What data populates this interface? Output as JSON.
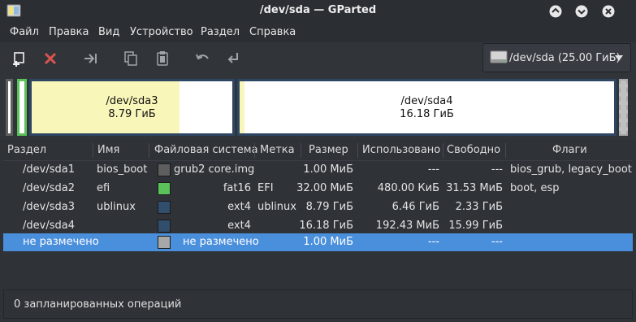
{
  "window": {
    "title": "/dev/sda — GParted",
    "colors": {
      "minimize": "#ffffff",
      "maximize": "#ffffff",
      "close": "#ffffff"
    }
  },
  "menu": {
    "items": [
      "Файл",
      "Правка",
      "Вид",
      "Устройство",
      "Раздел",
      "Справка"
    ]
  },
  "toolbar": {
    "buttons": [
      "new-partition-icon",
      "delete-icon",
      "resize-move-icon",
      "copy-icon",
      "paste-icon",
      "undo-icon",
      "apply-icon"
    ],
    "device": "/dev/sda (25.00 ГиБ)"
  },
  "disk_map": {
    "segments": [
      {
        "name": "/dev/sda3",
        "size": "8.79 ГиБ",
        "used_fraction": 0.735
      },
      {
        "name": "/dev/sda4",
        "size": "16.18 ГиБ",
        "used_fraction": 0.012
      }
    ]
  },
  "table": {
    "headers": [
      "Раздел",
      "Имя",
      "Файловая система",
      "Метка",
      "Размер",
      "Использовано",
      "Свободно",
      "Флаги"
    ],
    "rows": [
      {
        "partition": "/dev/sda1",
        "name": "bios_boot",
        "color": "#5e5e5e",
        "fs": "grub2 core.img",
        "label": "",
        "size": "1.00 МиБ",
        "used": "---",
        "free": "---",
        "flags": "bios_grub, legacy_boot"
      },
      {
        "partition": "/dev/sda2",
        "name": "efi",
        "color": "#5bc25b",
        "fs": "fat16",
        "label": "EFI",
        "size": "32.00 МиБ",
        "used": "480.00 КиБ",
        "free": "31.53 МиБ",
        "flags": "boot, esp"
      },
      {
        "partition": "/dev/sda3",
        "name": "ublinux",
        "color": "#314e6c",
        "fs": "ext4",
        "label": "ublinux",
        "size": "8.79 ГиБ",
        "used": "6.46 ГиБ",
        "free": "2.33 ГиБ",
        "flags": ""
      },
      {
        "partition": "/dev/sda4",
        "name": "",
        "color": "#314e6c",
        "fs": "ext4",
        "label": "",
        "size": "16.18 ГиБ",
        "used": "192.43 МиБ",
        "free": "15.99 ГиБ",
        "flags": ""
      },
      {
        "partition": "не размечено",
        "name": "",
        "color": "#a8a8a8",
        "fs": "не размечено",
        "label": "",
        "size": "1.00 МиБ",
        "used": "---",
        "free": "---",
        "flags": ""
      }
    ]
  },
  "status": {
    "text": "0 запланированных операций"
  }
}
